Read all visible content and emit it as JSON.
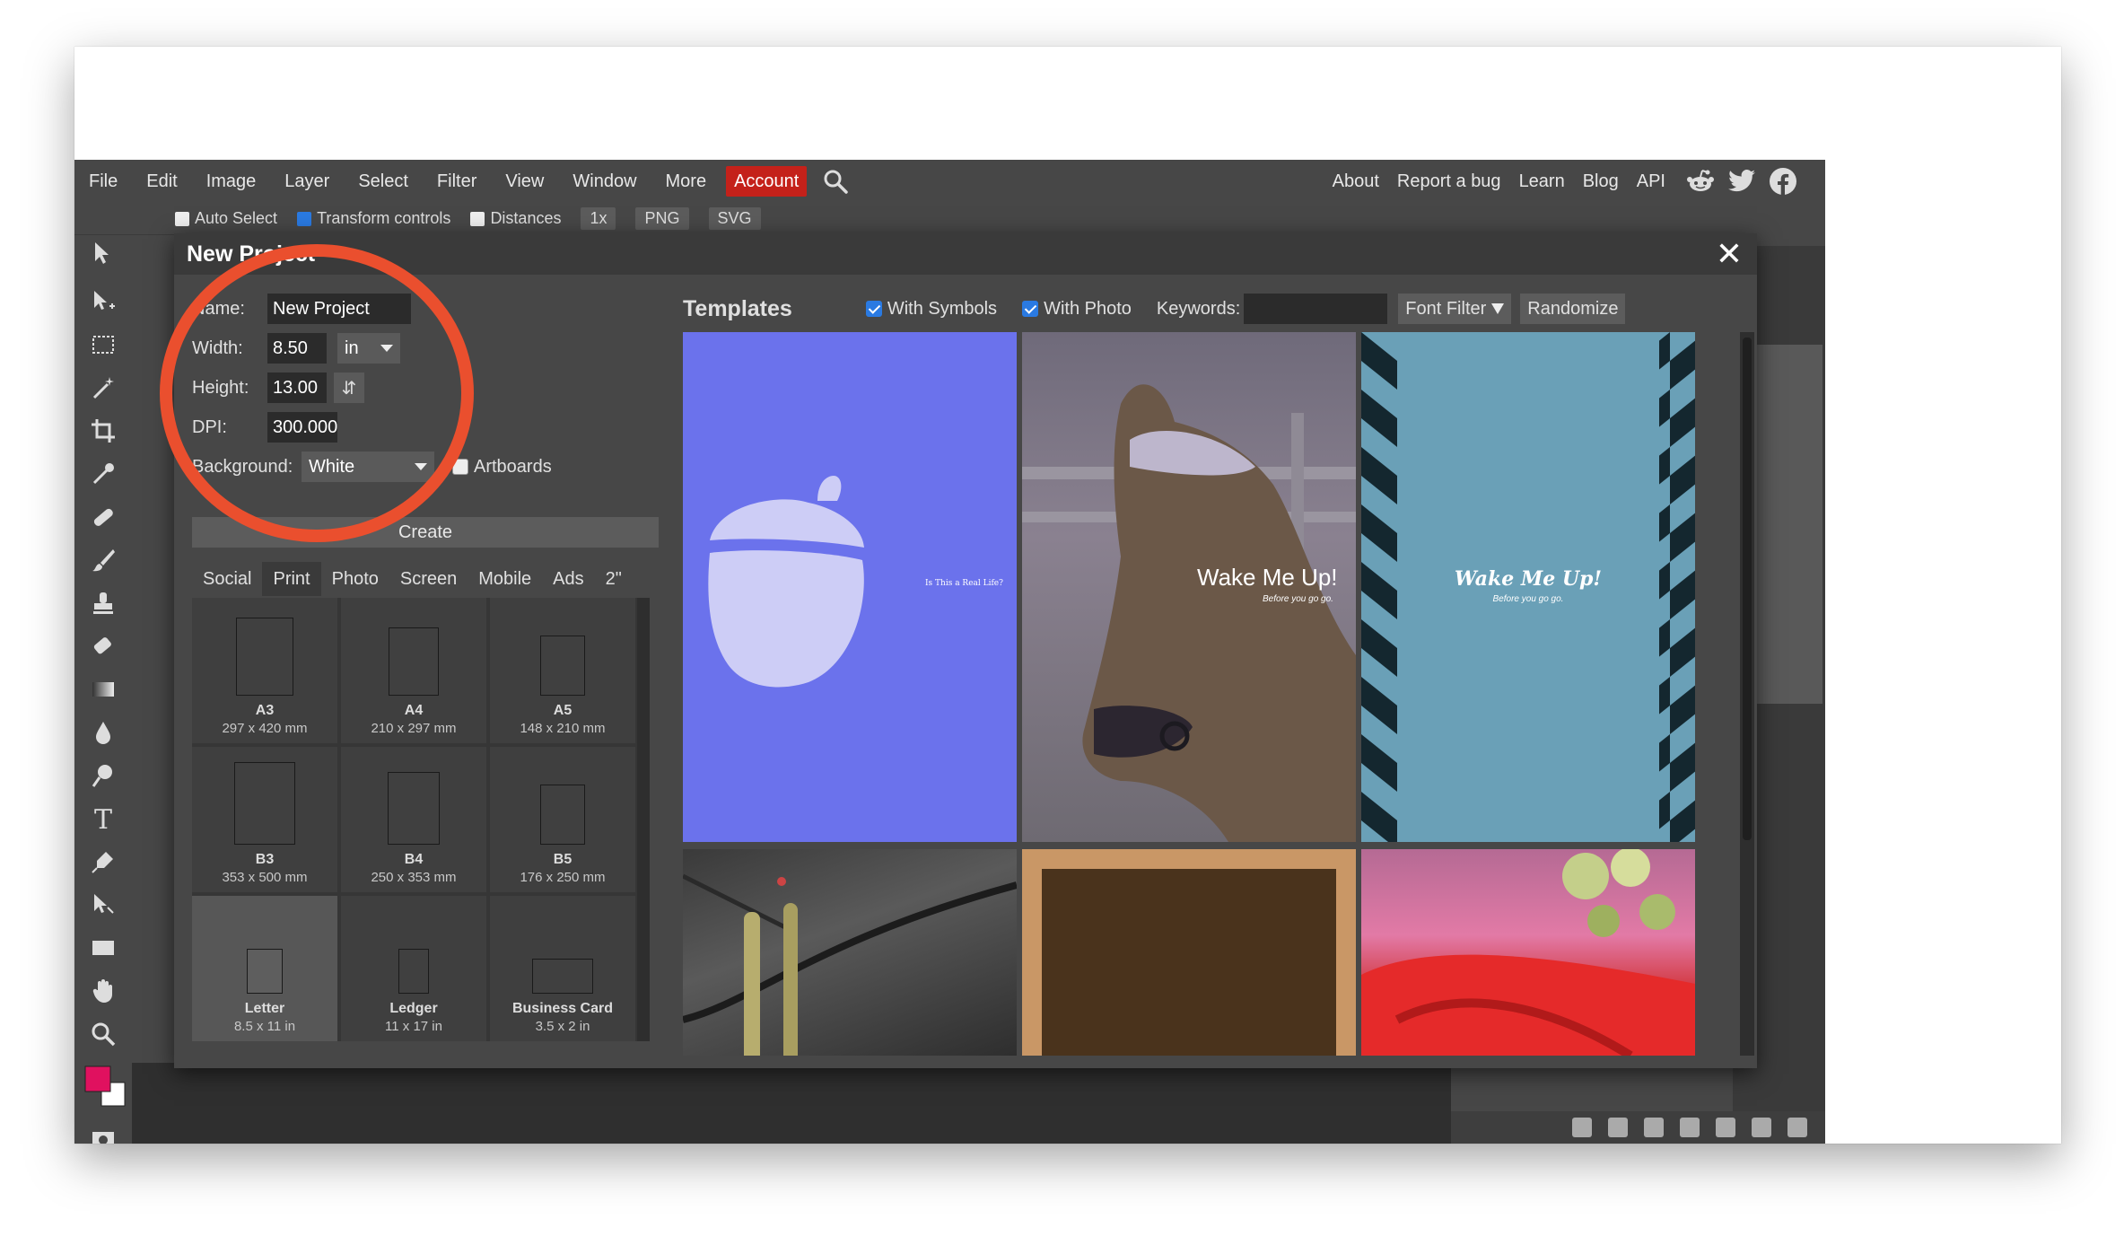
{
  "menu": {
    "left": [
      "File",
      "Edit",
      "Image",
      "Layer",
      "Select",
      "Filter",
      "View",
      "Window",
      "More"
    ],
    "account": "Account",
    "right": [
      "About",
      "Report a bug",
      "Learn",
      "Blog",
      "API"
    ]
  },
  "options": {
    "auto_select": "Auto Select",
    "transform_controls": "Transform controls",
    "distances": "Distances",
    "zoom": "1x",
    "png": "PNG",
    "svg": "SVG"
  },
  "dialog": {
    "title": "New Project",
    "close": "✕",
    "form": {
      "name_label": "Name:",
      "name_value": "New Project",
      "width_label": "Width:",
      "width_value": "8.50",
      "unit": "in",
      "height_label": "Height:",
      "height_value": "13.00",
      "dpi_label": "DPI:",
      "dpi_value": "300.000",
      "background_label": "Background:",
      "background_value": "White",
      "artboards_label": "Artboards",
      "create_label": "Create"
    },
    "tabs": [
      "Social",
      "Print",
      "Photo",
      "Screen",
      "Mobile",
      "Ads",
      "2\""
    ],
    "active_tab": "Print",
    "presets": [
      {
        "name": "A3",
        "dims": "297 x 420 mm"
      },
      {
        "name": "A4",
        "dims": "210 x 297 mm"
      },
      {
        "name": "A5",
        "dims": "148 x 210 mm"
      },
      {
        "name": "B3",
        "dims": "353 x 500 mm"
      },
      {
        "name": "B4",
        "dims": "250 x 353 mm"
      },
      {
        "name": "B5",
        "dims": "176 x 250 mm"
      },
      {
        "name": "Letter",
        "dims": "8.5 x 11 in"
      },
      {
        "name": "Ledger",
        "dims": "11 x 17 in"
      },
      {
        "name": "Business Card",
        "dims": "3.5 x 2 in"
      }
    ],
    "templates": {
      "title": "Templates",
      "with_symbols": "With Symbols",
      "with_photo": "With Photo",
      "keywords_label": "Keywords:",
      "font_filter": "Font Filter",
      "randomize": "Randomize",
      "t1_text": "Is This a Real Life?",
      "t2_title": "Wake Me Up!",
      "t2_sub": "Before you go go.",
      "t3_title": "Wake Me Up!",
      "t3_sub": "Before you go go."
    }
  },
  "colors": {
    "accent": "#c4211a",
    "annotation": "#ea4f2e",
    "foreground": "#e0115f",
    "checkbox": "#2a7ae2"
  },
  "icons": {
    "search": "magnifier-icon",
    "reddit": "reddit-icon",
    "twitter": "twitter-icon",
    "facebook": "facebook-icon"
  }
}
